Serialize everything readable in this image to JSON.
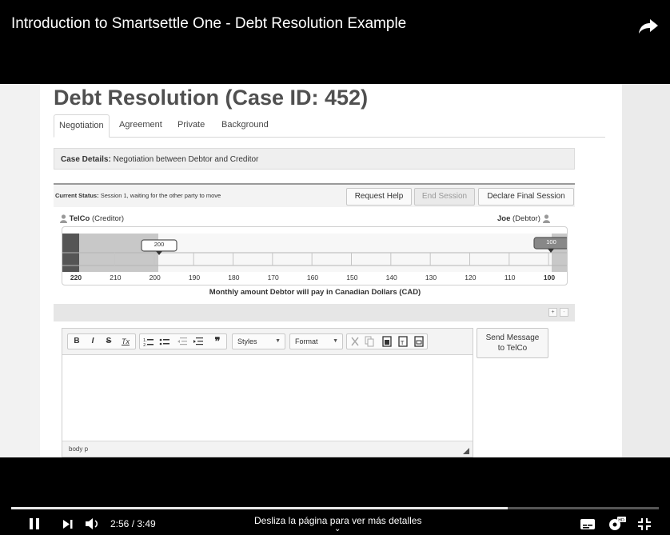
{
  "video": {
    "title": "Introduction to Smartsettle One - Debt Resolution Example",
    "current_time": "2:56 / 3:49",
    "progress_fraction": 0.767,
    "hint": "Desliza la página para ver más detalles"
  },
  "page": {
    "title": "Debt Resolution (Case ID: 452)",
    "tabs": [
      {
        "label": "Negotiation"
      },
      {
        "label": "Agreement"
      },
      {
        "label": "Private"
      },
      {
        "label": "Background"
      }
    ]
  },
  "case_details": {
    "label": "Case Details:",
    "text": "Negotiation between Debtor and Creditor"
  },
  "status": {
    "label": "Current Status:",
    "text": "Session 1, waiting for the other party to move",
    "buttons": {
      "help": "Request Help",
      "end": "End Session",
      "final": "Declare Final Session"
    }
  },
  "parties": {
    "left_name": "TelCo",
    "left_role": "(Creditor)",
    "right_name": "Joe",
    "right_role": "(Debtor)"
  },
  "slider": {
    "left_marker": "200",
    "right_marker": "100",
    "ticks": [
      "220",
      "210",
      "200",
      "190",
      "180",
      "170",
      "160",
      "150",
      "140",
      "130",
      "120",
      "110",
      "100"
    ],
    "axis_title": "Monthly amount Debtor will pay in Canadian Dollars (CAD)"
  },
  "zoom": {
    "plus": "+",
    "minus": "-"
  },
  "editor": {
    "bold": "B",
    "italic": "I",
    "strike": "S",
    "clear": "Tx",
    "styles": "Styles",
    "format": "Format",
    "footer": "body  p"
  },
  "send_button": {
    "line1": "Send Message",
    "line2": "to TelCo"
  },
  "colors": {
    "accent_dark": "#555555",
    "creditor_fill": "#c8c8c8",
    "page_bg": "#ffffff"
  }
}
